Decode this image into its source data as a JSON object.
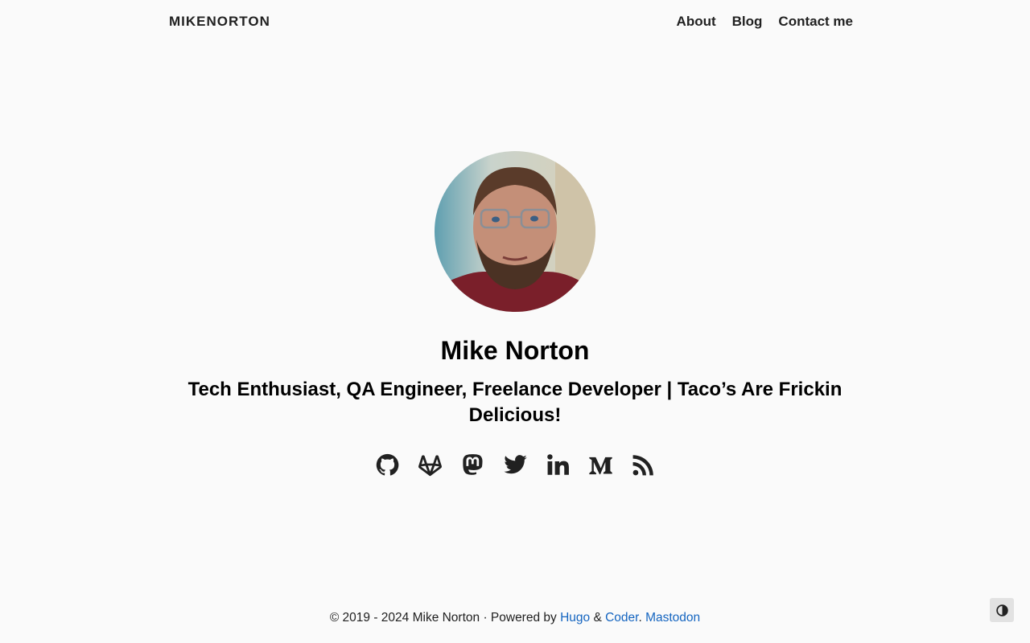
{
  "nav": {
    "brand": "MIKENORTON",
    "links": [
      "About",
      "Blog",
      "Contact me"
    ]
  },
  "profile": {
    "name": "Mike Norton",
    "tagline": "Tech Enthusiast, QA Engineer, Freelance Developer | Taco’s Are Frickin Delicious!",
    "avatar_icon": "profile-photo"
  },
  "socials": [
    {
      "name": "github",
      "icon": "github-icon"
    },
    {
      "name": "gitlab",
      "icon": "gitlab-icon"
    },
    {
      "name": "mastodon",
      "icon": "mastodon-icon"
    },
    {
      "name": "twitter",
      "icon": "twitter-icon"
    },
    {
      "name": "linkedin",
      "icon": "linkedin-icon"
    },
    {
      "name": "medium",
      "icon": "medium-icon"
    },
    {
      "name": "rss",
      "icon": "rss-icon"
    }
  ],
  "footer": {
    "copyright": "© 2019 - 2024 Mike Norton · Powered by ",
    "hugo": "Hugo",
    "amp": " & ",
    "coder": "Coder",
    "dot": ". ",
    "mastodon": "Mastodon"
  },
  "theme_toggle": {
    "icon": "contrast-icon"
  },
  "colors": {
    "background": "#fafafa",
    "text": "#212121",
    "link": "#1565c0"
  }
}
